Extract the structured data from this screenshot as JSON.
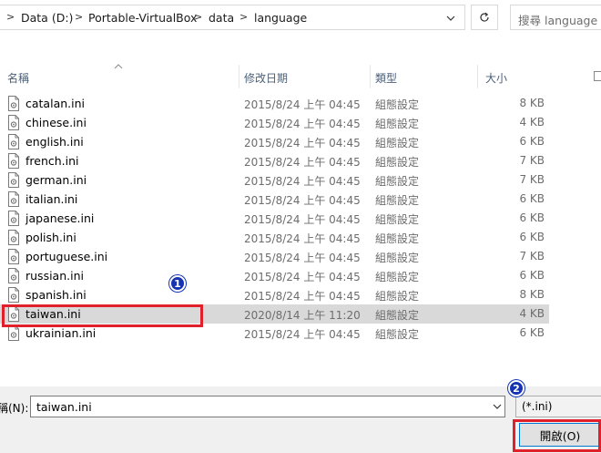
{
  "address_bar": {
    "crumbs": [
      "Data (D:)",
      "Portable-VirtualBox",
      "data",
      "language"
    ],
    "search_placeholder": "搜尋 language"
  },
  "columns": {
    "name": "名稱",
    "modified": "修改日期",
    "type": "類型",
    "size": "大小"
  },
  "files": [
    {
      "name": "catalan.ini",
      "modified": "2015/8/24 上午 04:45",
      "type": "組態設定",
      "size": "8 KB"
    },
    {
      "name": "chinese.ini",
      "modified": "2015/8/24 上午 04:45",
      "type": "組態設定",
      "size": "4 KB"
    },
    {
      "name": "english.ini",
      "modified": "2015/8/24 上午 04:45",
      "type": "組態設定",
      "size": "6 KB"
    },
    {
      "name": "french.ini",
      "modified": "2015/8/24 上午 04:45",
      "type": "組態設定",
      "size": "7 KB"
    },
    {
      "name": "german.ini",
      "modified": "2015/8/24 上午 04:45",
      "type": "組態設定",
      "size": "7 KB"
    },
    {
      "name": "italian.ini",
      "modified": "2015/8/24 上午 04:45",
      "type": "組態設定",
      "size": "6 KB"
    },
    {
      "name": "japanese.ini",
      "modified": "2015/8/24 上午 04:45",
      "type": "組態設定",
      "size": "6 KB"
    },
    {
      "name": "polish.ini",
      "modified": "2015/8/24 上午 04:45",
      "type": "組態設定",
      "size": "6 KB"
    },
    {
      "name": "portuguese.ini",
      "modified": "2015/8/24 上午 04:45",
      "type": "組態設定",
      "size": "7 KB"
    },
    {
      "name": "russian.ini",
      "modified": "2015/8/24 上午 04:45",
      "type": "組態設定",
      "size": "6 KB"
    },
    {
      "name": "spanish.ini",
      "modified": "2015/8/24 上午 04:45",
      "type": "組態設定",
      "size": "8 KB"
    },
    {
      "name": "taiwan.ini",
      "modified": "2020/8/14 上午 11:20",
      "type": "組態設定",
      "size": "4 KB",
      "selected": true
    },
    {
      "name": "ukrainian.ini",
      "modified": "2015/8/24 上午 04:45",
      "type": "組態設定",
      "size": "6 KB"
    }
  ],
  "bottom": {
    "filename_label": "稱(N):",
    "filename_value": "taiwan.ini",
    "filter": "(*.ini)",
    "open_button": "開啟(O)"
  },
  "annotations": {
    "badge1": "1",
    "badge2": "2",
    "highlight_color": "#e0202a",
    "badge_color": "#1533b3"
  },
  "colors": {
    "selected_row": "#d9d9d9",
    "header_text": "#4c607a",
    "button_border": "#0078d7"
  },
  "icons": {
    "file": "config-file-icon",
    "refresh": "refresh-icon",
    "dropdown": "chevron-down-icon",
    "sort": "sort-up-icon"
  }
}
